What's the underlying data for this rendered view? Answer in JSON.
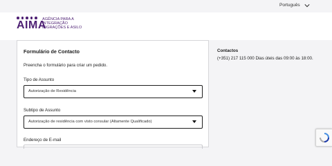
{
  "topbar": {
    "language": "Português",
    "chevron_icon": "chevron-down-icon"
  },
  "header": {
    "logo_text": "AIMA",
    "tagline": [
      "AGÊNCIA PARA A",
      "INTEGRAÇÃO",
      "MIGRAÇÕES E ASILO"
    ],
    "brand_color": "#4d1f73"
  },
  "form": {
    "title": "Formulário de Contacto",
    "subtitle": "Preencha o formulário para criar um pedido.",
    "fields": [
      {
        "label": "Tipo de Assunto",
        "value": "Autorização de Residência"
      },
      {
        "label": "Subtipo de Assunto",
        "value": "Autorização de residência com visto consular (Altamente Qualificado)"
      },
      {
        "label": "Endereço de E-mail"
      }
    ]
  },
  "contacts": {
    "title": "Contactos",
    "text": "(+351) 217 115 000 Dias úteis das 09:00 às 18:00."
  },
  "recaptcha": {
    "icon": "recaptcha-icon"
  }
}
